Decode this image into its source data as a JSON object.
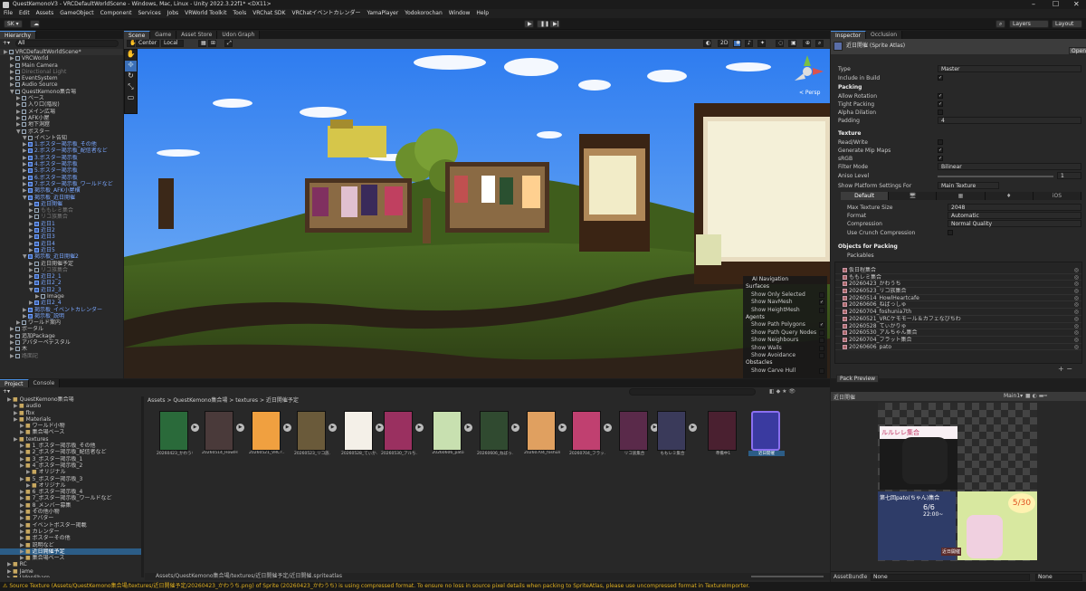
{
  "window": {
    "title": "QuestKemonoV3 - VRCDefaultWorldScene - Windows, Mac, Linux - Unity 2022.3.22f1* <DX11>",
    "minimize": "–",
    "maximize": "☐",
    "close": "✕"
  },
  "menu": [
    "File",
    "Edit",
    "Assets",
    "GameObject",
    "Component",
    "Services",
    "Jobs",
    "VRWorld Toolkit",
    "Tools",
    "VRChat SDK",
    "VRChatイベントカレンダー",
    "YamaPlayer",
    "Yodokorochan",
    "Window",
    "Help"
  ],
  "toolbar": {
    "account": "SK ▾",
    "play": "▶",
    "pause": "❚❚",
    "step": "▶|",
    "layers": "Layers",
    "layout": "Layout"
  },
  "hierarchy": {
    "tab": "Hierarchy",
    "search_placeholder": "All",
    "rows": [
      {
        "t": "VRCDefaultWorldScene*",
        "d": 0,
        "kind": "scene"
      },
      {
        "t": "VRCWorld",
        "d": 1
      },
      {
        "t": "Main Camera",
        "d": 1
      },
      {
        "t": "Directional Light",
        "d": 1,
        "kind": "grey"
      },
      {
        "t": "EventSystem",
        "d": 1
      },
      {
        "t": "Audio Source",
        "d": 1
      },
      {
        "t": "QuestKemono集合場",
        "d": 1,
        "open": true
      },
      {
        "t": "ベース",
        "d": 2
      },
      {
        "t": "入り口(階段)",
        "d": 2
      },
      {
        "t": "メイン広場",
        "d": 2
      },
      {
        "t": "AFK小屋",
        "d": 2
      },
      {
        "t": "地下洞窟",
        "d": 2
      },
      {
        "t": "ポスター",
        "d": 2,
        "open": true
      },
      {
        "t": "イベント告知",
        "d": 3,
        "open": true
      },
      {
        "t": "1.ポスター掲示板_その他",
        "d": 3,
        "kind": "blue"
      },
      {
        "t": "2.ポスター掲示板_配信者など",
        "d": 3,
        "kind": "blue"
      },
      {
        "t": "3.ポスター掲示板",
        "d": 3,
        "kind": "blue"
      },
      {
        "t": "4.ポスター掲示板",
        "d": 3,
        "kind": "blue"
      },
      {
        "t": "5.ポスター掲示板",
        "d": 3,
        "kind": "blue"
      },
      {
        "t": "6.ポスター掲示板",
        "d": 3,
        "kind": "blue"
      },
      {
        "t": "7.ポスター掲示板_ワールドなど",
        "d": 3,
        "kind": "blue"
      },
      {
        "t": "掲示板_AFK小屋横",
        "d": 3,
        "kind": "blue"
      },
      {
        "t": "掲示板_近日開催",
        "d": 3,
        "kind": "blue",
        "open": true
      },
      {
        "t": "近日開催",
        "d": 4,
        "kind": "blue"
      },
      {
        "t": "ももレミ集合",
        "d": 4,
        "kind": "grey"
      },
      {
        "t": "リコ族集合",
        "d": 4,
        "kind": "grey"
      },
      {
        "t": "近日1",
        "d": 4,
        "kind": "blue"
      },
      {
        "t": "近日2",
        "d": 4,
        "kind": "blue"
      },
      {
        "t": "近日3",
        "d": 4,
        "kind": "blue"
      },
      {
        "t": "近日4",
        "d": 4,
        "kind": "blue"
      },
      {
        "t": "近日5",
        "d": 4,
        "kind": "blue"
      },
      {
        "t": "掲示板_近日開催2",
        "d": 3,
        "kind": "blue",
        "open": true
      },
      {
        "t": "近日開催予定",
        "d": 4
      },
      {
        "t": "リコ族集合",
        "d": 4,
        "kind": "grey"
      },
      {
        "t": "近日2_1",
        "d": 4,
        "kind": "blue"
      },
      {
        "t": "近日2_2",
        "d": 4,
        "kind": "blue"
      },
      {
        "t": "近日2_3",
        "d": 4,
        "kind": "blue",
        "open": true
      },
      {
        "t": "Image",
        "d": 5
      },
      {
        "t": "近日2_4",
        "d": 4,
        "kind": "blue"
      },
      {
        "t": "掲示板_イベントカレンダー",
        "d": 3,
        "kind": "blue"
      },
      {
        "t": "掲示板_説明",
        "d": 3,
        "kind": "blue"
      },
      {
        "t": "ワールド案内",
        "d": 2
      },
      {
        "t": "ポータル",
        "d": 1
      },
      {
        "t": "追加Package",
        "d": 1
      },
      {
        "t": "アバターペデスタル",
        "d": 1
      },
      {
        "t": "木",
        "d": 1
      },
      {
        "t": "路面記",
        "d": 1,
        "kind": "grey"
      }
    ]
  },
  "scene": {
    "tabs": [
      "Scene",
      "Game",
      "Asset Store",
      "Udon Graph"
    ],
    "center": "Center",
    "local": "Local",
    "persp": "< Persp",
    "view2d": "2D"
  },
  "ai_nav": {
    "title": "AI Navigation",
    "surfaces": "Surfaces",
    "s_items": [
      "Show Only Selected",
      "Show NavMesh",
      "Show HeightMesh"
    ],
    "s_checked": [
      false,
      true,
      false
    ],
    "agents": "Agents",
    "a_items": [
      "Show Path Polygons",
      "Show Path Query Nodes",
      "Show Neighbours",
      "Show Walls",
      "Show Avoidance"
    ],
    "a_checked": [
      true,
      false,
      false,
      false,
      false
    ],
    "obstacles": "Obstacles",
    "o_items": [
      "Show Carve Hull"
    ],
    "o_checked": [
      false
    ]
  },
  "inspector": {
    "tabs": [
      "Inspector",
      "Occlusion"
    ],
    "title": "近日開催 (Sprite Atlas)",
    "open": "Open",
    "type_label": "Type",
    "type_value": "Master",
    "include": "Include in Build",
    "packing": "Packing",
    "allow_rotation": "Allow Rotation",
    "tight_packing": "Tight Packing",
    "alpha_dilation": "Alpha Dilation",
    "padding": "Padding",
    "padding_value": "4",
    "texture": "Texture",
    "read_write": "Read/Write",
    "mipmaps": "Generate Mip Maps",
    "srgb": "sRGB",
    "filter": "Filter Mode",
    "filter_value": "Bilinear",
    "aniso": "Aniso Level",
    "aniso_value": "1",
    "platform": "Show Platform Settings For",
    "platform_value": "Main Texture",
    "platform_tabs": [
      "Default",
      "🖥",
      "▦",
      "♦",
      "iOS"
    ],
    "max_size": "Max Texture Size",
    "max_size_value": "2048",
    "format": "Format",
    "format_value": "Automatic",
    "compression": "Compression",
    "compression_value": "Normal Quality",
    "crunch": "Use Crunch Compression",
    "objects": "Objects for Packing",
    "packables": "Packables",
    "items": [
      "仮日程集合",
      "ももレミ集合",
      "20260423_かわうち",
      "20260523_リコ族集合",
      "20260514_HowlHeartcafe",
      "20260606_ねばっしゅ",
      "20260704_foshunia7th",
      "20260521_VRCケモモール＆カフェなびちわ",
      "20260528_てぃかりゅ",
      "20260530_アルちゃん集合",
      "20260704_フラット集合",
      "20260606_pato"
    ],
    "pack_preview": "Pack Preview"
  },
  "preview": {
    "name": "近日開催",
    "main": "Main1▾",
    "poster1": "ルルレレ集合",
    "poster2": "第七回pato(ちゃん)集合",
    "date": "6/6",
    "time": "22:00~",
    "big": "5/30",
    "corner": "近日開催"
  },
  "assetbundle": {
    "label": "AssetBundle",
    "value": "None",
    "variant": "None"
  },
  "project": {
    "tabs": [
      "Project",
      "Console"
    ],
    "tree": [
      "QuestKemono集合場",
      "audio",
      "fbx",
      "Materials",
      "ワールド小物",
      "集合場ベース",
      "textures",
      "1_ポスター掲示板_その他",
      "2_ポスター掲示板_配信者など",
      "3_ポスター掲示板_1",
      "4_ポスター掲示板_2",
      "オリジナル",
      "5_ポスター掲示板_3",
      "オリジナル",
      "6_ポスター掲示板_4",
      "7_ポスター掲示板_ワールドなど",
      "8_メンバー募集",
      "その他小物",
      "アバター",
      "イベントポスター掲載",
      "カレンダー",
      "ポスターその他",
      "説明など",
      "近日開催予定",
      "集合場ベース",
      "RC",
      "Jame",
      "UdonSharp"
    ],
    "breadcrumb": [
      "Assets",
      "QuestKemono集合場",
      "textures",
      "近日開催予定"
    ],
    "assets": [
      "20260423_かわうち",
      "20260514_HowlH...",
      "20260521_VRC?...",
      "20260523_リコ族...",
      "20260528_てぃか...",
      "20260530_アルち...",
      "20260606_pato",
      "20260606_ねばっ...",
      "20260704_foshun...",
      "20260704_フラッ...",
      "リコ族集合",
      "ももレミ集合",
      "準備中1",
      "近日開催"
    ],
    "path": "Assets/QuestKemono集合場/textures/近日開催予定/近日開催.spriteatlas"
  },
  "status": "Source Texture (Assets/QuestKemono集合場/textures/近日開催予定/20260423_かわうち.png) of Sprite (20260423_かわうち) is using compressed format. To ensure no loss in source pixel details when packing to SpriteAtlas, please use uncompressed format in TextureImporter.",
  "colors": {
    "accent": "#4a90e2",
    "warning": "#ffc107",
    "selection": "#2c5d87"
  }
}
